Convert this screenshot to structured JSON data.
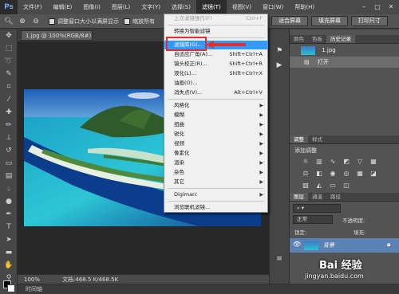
{
  "app": {
    "logo": "Ps"
  },
  "menubar": {
    "items": [
      "文件(F)",
      "编辑(E)",
      "图像(I)",
      "图层(L)",
      "文字(Y)",
      "选择(S)",
      "滤镜(T)",
      "视图(V)",
      "窗口(W)",
      "帮助(H)"
    ],
    "active_index": 6
  },
  "options_bar": {
    "resize_window_label": "调整窗口大小以满屏显示",
    "zoom_all_label": "缩放所有",
    "fit_screen_button": "适合屏幕",
    "fill_screen_button": "填充屏幕",
    "print_size_button": "打印尺寸"
  },
  "document": {
    "tab_title": "1.jpg @ 100%(RGB/8#)",
    "zoom": "100%",
    "doc_size": "文档:468.5 K/468.5K"
  },
  "bottom_bar": {
    "label": "时间轴"
  },
  "filter_menu": {
    "items": [
      {
        "label": "上次滤镜操作(F)",
        "shortcut": "Ctrl+F",
        "disabled": true
      },
      {
        "label": "转换为智能滤镜",
        "shortcut": ""
      },
      {
        "label": "滤镜库(G)...",
        "shortcut": "",
        "highlighted": true
      },
      {
        "label": "自适应广角(A)...",
        "shortcut": "Shift+Ctrl+A"
      },
      {
        "label": "镜头校正(R)...",
        "shortcut": "Shift+Ctrl+R"
      },
      {
        "label": "液化(L)...",
        "shortcut": "Shift+Ctrl+X"
      },
      {
        "label": "油画(O)...",
        "shortcut": ""
      },
      {
        "label": "消失点(V)...",
        "shortcut": "Alt+Ctrl+V"
      },
      {
        "label": "风格化",
        "submenu": true
      },
      {
        "label": "模糊",
        "submenu": true
      },
      {
        "label": "扭曲",
        "submenu": true
      },
      {
        "label": "锐化",
        "submenu": true
      },
      {
        "label": "视频",
        "submenu": true
      },
      {
        "label": "像素化",
        "submenu": true
      },
      {
        "label": "渲染",
        "submenu": true
      },
      {
        "label": "杂色",
        "submenu": true
      },
      {
        "label": "其它",
        "submenu": true
      },
      {
        "label": "Digimarc",
        "submenu": true
      },
      {
        "label": "浏览联机滤镜...",
        "shortcut": ""
      }
    ]
  },
  "panels": {
    "top_tabs": [
      "颜色",
      "色板",
      "历史记录"
    ],
    "history": {
      "snapshot": "1.jpg",
      "step": "打开"
    },
    "adjust_tabs": [
      "调整",
      "样式"
    ],
    "adjust_title": "添加调整",
    "layers_tabs": [
      "图层",
      "通道",
      "路径"
    ],
    "blend_mode": "正常",
    "opacity_label": "不透明度:",
    "fill_label": "填充:",
    "lock_label": "锁定:",
    "layer_name": "背景"
  },
  "watermark": {
    "brand": "Bai 经验",
    "url": "jingyan.baidu.com"
  },
  "colors": {
    "highlight": "#3399ff",
    "annotation": "#e03030"
  }
}
